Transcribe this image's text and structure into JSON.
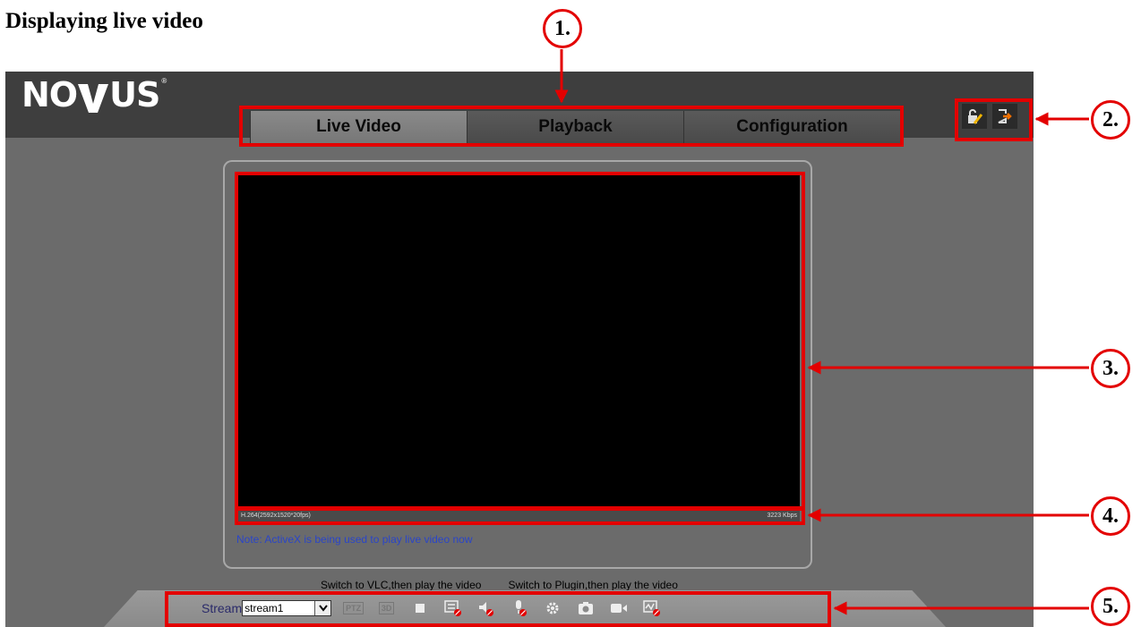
{
  "heading": "Displaying live video",
  "logo": {
    "text_left": "NO",
    "text_right": "US",
    "mark": "®"
  },
  "tabs": [
    {
      "label": "Live Video",
      "active": true
    },
    {
      "label": "Playback",
      "active": false
    },
    {
      "label": "Configuration",
      "active": false
    }
  ],
  "top_icons": [
    "lock-edit-icon",
    "logout-icon"
  ],
  "video": {
    "codec_info": "H.264(2592x1520*20fps)",
    "bitrate": "3223 Kbps"
  },
  "note": "Note: ActiveX is being used to play live video now",
  "switch_links": {
    "vlc": "Switch to VLC,then play the video",
    "plugin": "Switch to Plugin,then play the video"
  },
  "toolbar": {
    "stream_label": "Stream",
    "stream_value": "stream1",
    "ptz": "PTZ",
    "threed": "3D",
    "icons": [
      "stop-icon",
      "osd-icon",
      "audio-icon",
      "microphone-icon",
      "settings-icon",
      "snapshot-icon",
      "record-icon",
      "motion-icon"
    ]
  },
  "callouts": [
    "1.",
    "2.",
    "3.",
    "4.",
    "5."
  ],
  "colors": {
    "accent": "#e30000",
    "topbar": "#3e3e3e",
    "background": "#6b6b6b",
    "note": "#2a45c8"
  }
}
